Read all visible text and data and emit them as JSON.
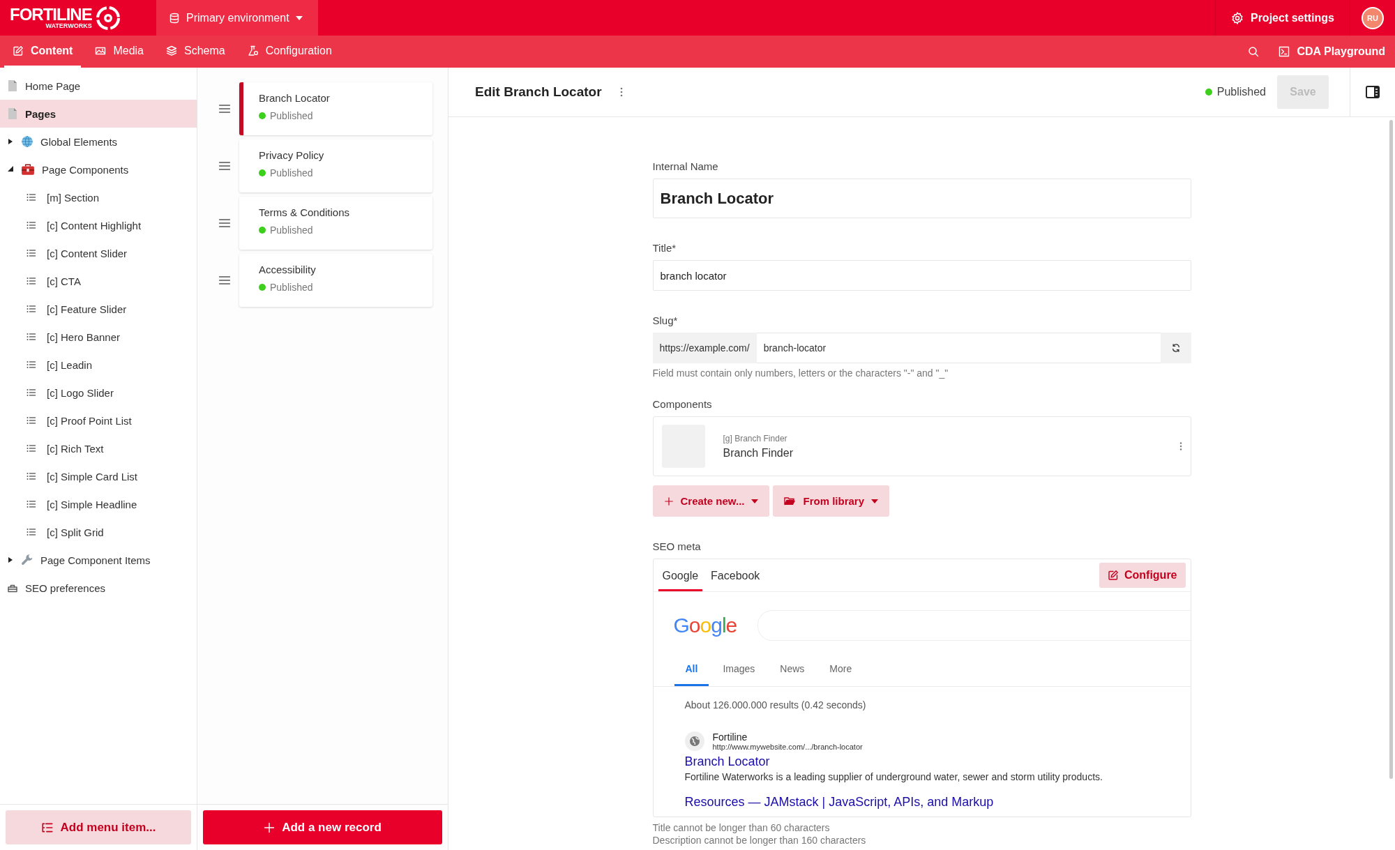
{
  "header": {
    "logo": "FORTILINE",
    "logo_sub": "WATERWORKS",
    "environment": "Primary environment",
    "project_settings": "Project settings",
    "avatar": "RU"
  },
  "nav": {
    "tabs": [
      {
        "label": "Content",
        "kind": "content",
        "selected": true
      },
      {
        "label": "Media",
        "kind": "media",
        "selected": false
      },
      {
        "label": "Schema",
        "kind": "schema",
        "selected": false
      },
      {
        "label": "Configuration",
        "kind": "configuration",
        "selected": false
      }
    ],
    "cda": "CDA Playground"
  },
  "sidebar": {
    "items": [
      {
        "label": "Home Page",
        "kind": "page",
        "selected": false
      },
      {
        "label": "Pages",
        "kind": "page",
        "selected": true
      },
      {
        "label": "Global Elements",
        "kind": "globe",
        "selected": false,
        "expanded": false
      },
      {
        "label": "Page Components",
        "kind": "toolbox",
        "selected": false,
        "expanded": true,
        "children": [
          {
            "label": "[m] Section",
            "kind": "model",
            "selected": false
          },
          {
            "label": "[c] Content Highlight",
            "kind": "model",
            "selected": false
          },
          {
            "label": "[c] Content Slider",
            "kind": "model",
            "selected": false
          },
          {
            "label": "[c] CTA",
            "kind": "model",
            "selected": false
          },
          {
            "label": "[c] Feature Slider",
            "kind": "model",
            "selected": false
          },
          {
            "label": "[c] Hero Banner",
            "kind": "model",
            "selected": false
          },
          {
            "label": "[c] Leadin",
            "kind": "model",
            "selected": false
          },
          {
            "label": "[c] Logo Slider",
            "kind": "model",
            "selected": false
          },
          {
            "label": "[c] Proof Point List",
            "kind": "model",
            "selected": false
          },
          {
            "label": "[c] Rich Text",
            "kind": "model",
            "selected": false
          },
          {
            "label": "[c] Simple Card List",
            "kind": "model",
            "selected": false
          },
          {
            "label": "[c] Simple Headline",
            "kind": "model",
            "selected": false
          },
          {
            "label": "[c] Split Grid",
            "kind": "model",
            "selected": false
          }
        ]
      },
      {
        "label": "Page Component Items",
        "kind": "wrench",
        "selected": false,
        "expanded": false
      },
      {
        "label": "SEO preferences",
        "kind": "settings",
        "selected": false
      }
    ],
    "add_button": "Add menu item..."
  },
  "records": {
    "items": [
      {
        "title": "Branch Locator",
        "status": "Published",
        "selected": true
      },
      {
        "title": "Privacy Policy",
        "status": "Published",
        "selected": false
      },
      {
        "title": "Terms & Conditions",
        "status": "Published",
        "selected": false
      },
      {
        "title": "Accessibility",
        "status": "Published",
        "selected": false
      }
    ],
    "add_button": "Add a new record"
  },
  "editor": {
    "title": "Edit Branch Locator",
    "status": "Published",
    "save": {
      "label": "Save",
      "disabled": true
    },
    "internal_name": {
      "label": "Internal Name",
      "value": "Branch Locator"
    },
    "title_field": {
      "label": "Title*",
      "value": "branch locator"
    },
    "slug": {
      "label": "Slug*",
      "prefix": "https://example.com/",
      "value": "branch-locator",
      "hint": "Field must contain only numbers, letters or the characters \"-\" and \"_\""
    },
    "components": {
      "label": "Components",
      "items": [
        {
          "type": "[g] Branch Finder",
          "name": "Branch Finder"
        }
      ],
      "create": "Create new...",
      "library": "From library"
    },
    "seo": {
      "label": "SEO meta",
      "tabs": [
        {
          "label": "Google",
          "selected": true
        },
        {
          "label": "Facebook",
          "selected": false
        }
      ],
      "configure": "Configure",
      "preview": {
        "logo": "Google",
        "tabs": [
          {
            "label": "All",
            "selected": true
          },
          {
            "label": "Images",
            "selected": false
          },
          {
            "label": "News",
            "selected": false
          },
          {
            "label": "More",
            "selected": false
          }
        ],
        "stats": "About 126.000.000 results (0.42 seconds)",
        "site": "Fortiline",
        "url": "http://www.mywebsite.com/.../branch-locator",
        "result_title": "Branch Locator",
        "description": "Fortiline Waterworks is a leading supplier of underground water, sewer and storm utility products.",
        "next_title": "Resources — JAMstack | JavaScript, APIs, and Markup"
      },
      "hints": [
        "Title cannot be longer than 60 characters",
        "Description cannot be longer than 160 characters"
      ]
    }
  }
}
